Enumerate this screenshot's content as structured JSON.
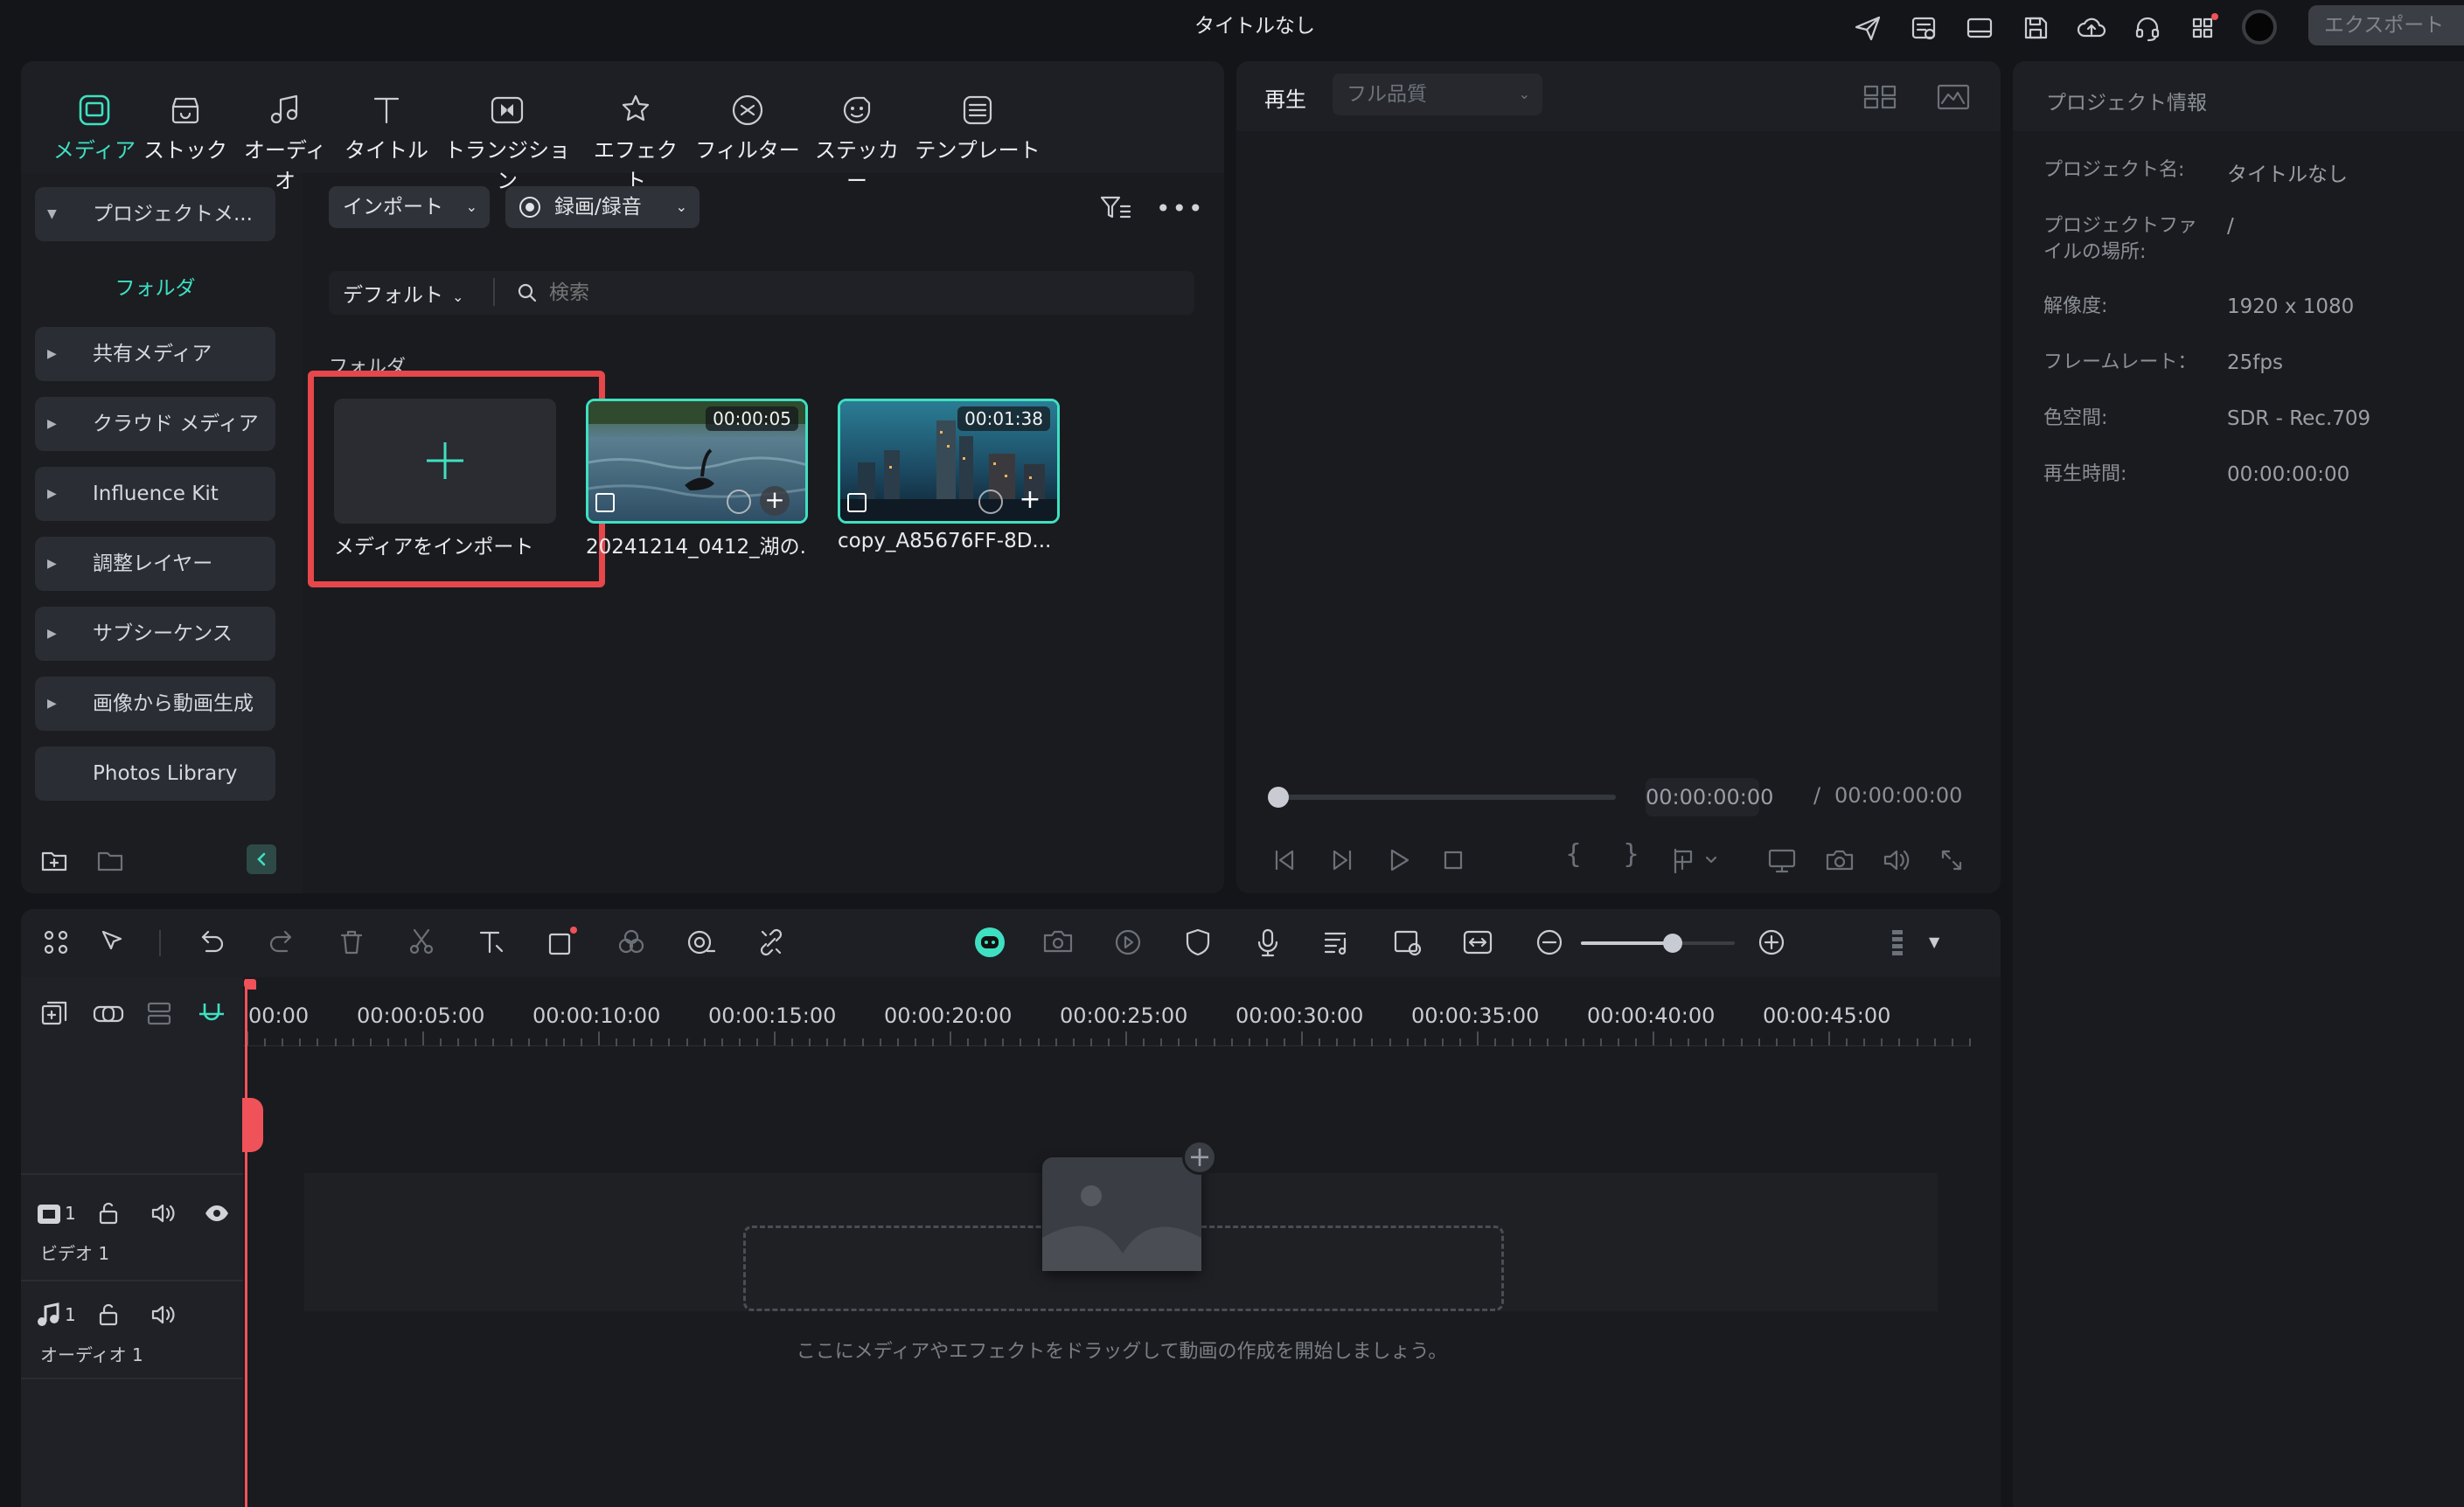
{
  "window": {
    "title": "タイトルなし",
    "export_label": "エクスポート"
  },
  "media_tabs": [
    {
      "label": "メディア",
      "icon": "media-icon",
      "active": true
    },
    {
      "label": "ストック",
      "icon": "stock-icon"
    },
    {
      "label": "オーディオ",
      "icon": "music-note-icon"
    },
    {
      "label": "タイトル",
      "icon": "title-t-icon"
    },
    {
      "label": "トランジション",
      "icon": "transition-icon"
    },
    {
      "label": "エフェクト",
      "icon": "effect-icon"
    },
    {
      "label": "フィルター",
      "icon": "filter-icon"
    },
    {
      "label": "ステッカー",
      "icon": "sticker-icon"
    },
    {
      "label": "テンプレート",
      "icon": "template-icon"
    }
  ],
  "sidebar": {
    "project_media": "プロジェクトメ...",
    "folder": "フォルダ",
    "items": [
      {
        "label": "共有メディア"
      },
      {
        "label": "クラウド メディア"
      },
      {
        "label": "Influence Kit"
      },
      {
        "label": "調整レイヤー"
      },
      {
        "label": "サブシーケンス"
      },
      {
        "label": "画像から動画生成"
      },
      {
        "label": "Photos Library"
      }
    ]
  },
  "media_panel": {
    "import_label": "インポート",
    "record_label": "録画/録音",
    "sort_label": "デフォルト",
    "search_placeholder": "検索",
    "section_label": "フォルダ",
    "import_card_label": "メディアをインポート",
    "clips": [
      {
        "name": "20241214_0412_湖の...",
        "duration": "00:00:05"
      },
      {
        "name": "copy_A85676FF-8D...",
        "duration": "00:01:38"
      }
    ]
  },
  "player": {
    "tab": "再生",
    "quality": "フル品質",
    "current_time": "00:00:00:00",
    "separator": "/",
    "total_time": "00:00:00:00",
    "progress": 0
  },
  "project_info": {
    "title": "プロジェクト情報",
    "rows": [
      {
        "label": "プロジェクト名:",
        "value": "タイトルなし"
      },
      {
        "label": "プロジェクトファイルの場所:",
        "value": "/"
      },
      {
        "label": "解像度:",
        "value": "1920 x 1080"
      },
      {
        "label": "フレームレート：",
        "value": "25fps"
      },
      {
        "label": "色空間:",
        "value": "SDR - Rec.709"
      },
      {
        "label": "再生時間:",
        "value": "00:00:00:00"
      }
    ]
  },
  "timeline": {
    "ruler": [
      "00:00",
      "00:00:05:00",
      "00:00:10:00",
      "00:00:15:00",
      "00:00:20:00",
      "00:00:25:00",
      "00:00:30:00",
      "00:00:35:00",
      "00:00:40:00",
      "00:00:45:00"
    ],
    "video_track": {
      "number": "1",
      "label": "ビデオ 1"
    },
    "audio_track": {
      "number": "1",
      "label": "オーディオ 1"
    },
    "drop_hint": "ここにメディアやエフェクトをドラッグして動画の作成を開始しましょう。",
    "zoom_level": 0.6
  },
  "colors": {
    "accent": "#3fe0c2",
    "highlight_red": "#e5474b",
    "playhead": "#f0525a"
  }
}
